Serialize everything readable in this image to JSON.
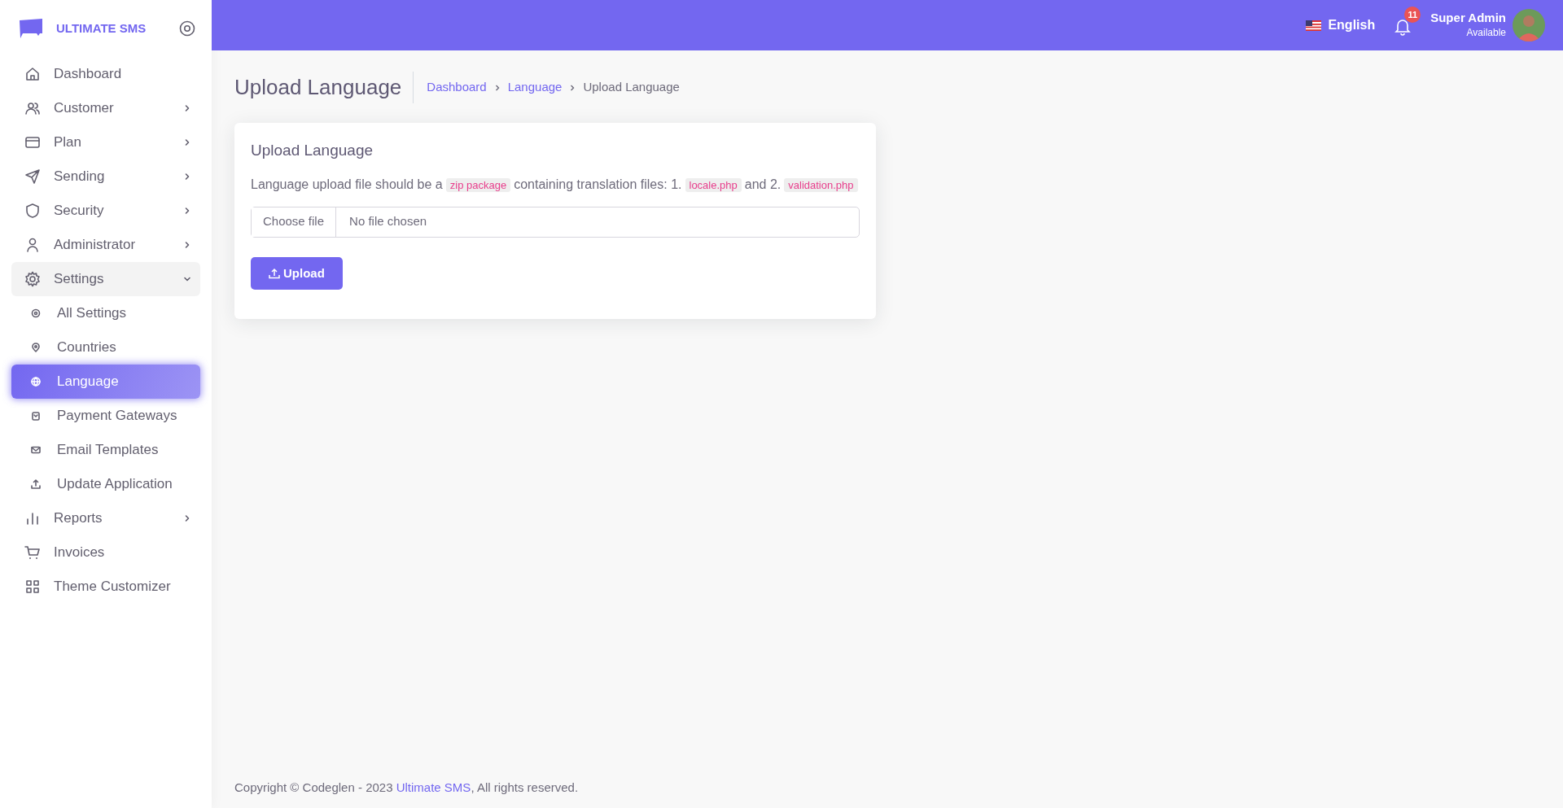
{
  "brand": {
    "name": "ULTIMATE SMS"
  },
  "sidebar": {
    "items": [
      {
        "label": "Dashboard",
        "kind": "main",
        "has_submenu": false,
        "expanded": false,
        "selected": false
      },
      {
        "label": "Customer",
        "kind": "main",
        "has_submenu": true,
        "expanded": false,
        "selected": false
      },
      {
        "label": "Plan",
        "kind": "main",
        "has_submenu": true,
        "expanded": false,
        "selected": false
      },
      {
        "label": "Sending",
        "kind": "main",
        "has_submenu": true,
        "expanded": false,
        "selected": false
      },
      {
        "label": "Security",
        "kind": "main",
        "has_submenu": true,
        "expanded": false,
        "selected": false
      },
      {
        "label": "Administrator",
        "kind": "main",
        "has_submenu": true,
        "expanded": false,
        "selected": false
      },
      {
        "label": "Settings",
        "kind": "main",
        "has_submenu": true,
        "expanded": true,
        "selected": false
      },
      {
        "label": "All Settings",
        "kind": "sub",
        "has_submenu": false,
        "expanded": false,
        "selected": false
      },
      {
        "label": "Countries",
        "kind": "sub",
        "has_submenu": false,
        "expanded": false,
        "selected": false
      },
      {
        "label": "Language",
        "kind": "sub",
        "has_submenu": false,
        "expanded": false,
        "selected": true
      },
      {
        "label": "Payment Gateways",
        "kind": "sub",
        "has_submenu": false,
        "expanded": false,
        "selected": false
      },
      {
        "label": "Email Templates",
        "kind": "sub",
        "has_submenu": false,
        "expanded": false,
        "selected": false
      },
      {
        "label": "Update Application",
        "kind": "sub",
        "has_submenu": false,
        "expanded": false,
        "selected": false
      },
      {
        "label": "Reports",
        "kind": "main",
        "has_submenu": true,
        "expanded": false,
        "selected": false
      },
      {
        "label": "Invoices",
        "kind": "main",
        "has_submenu": false,
        "expanded": false,
        "selected": false
      },
      {
        "label": "Theme Customizer",
        "kind": "main",
        "has_submenu": false,
        "expanded": false,
        "selected": false
      }
    ]
  },
  "topbar": {
    "language": "English",
    "notification_count": "11",
    "user_name": "Super Admin",
    "user_status": "Available"
  },
  "page": {
    "title": "Upload Language",
    "breadcrumb": [
      {
        "label": "Dashboard",
        "kind": "link"
      },
      {
        "label": "Language",
        "kind": "link"
      },
      {
        "label": "Upload Language",
        "kind": "current"
      }
    ]
  },
  "card": {
    "title": "Upload Language",
    "description": [
      {
        "kind": "text",
        "text": "Language upload file should be a"
      },
      {
        "kind": "code",
        "text": "zip package"
      },
      {
        "kind": "text",
        "text": "containing translation files: 1."
      },
      {
        "kind": "code",
        "text": "locale.php"
      },
      {
        "kind": "text",
        "text": "and 2."
      },
      {
        "kind": "code",
        "text": "validation.php"
      }
    ],
    "file_button": "Choose file",
    "file_status": "No file chosen",
    "submit": "Upload"
  },
  "footer": {
    "copyright": "Copyright © Codeglen - 2023",
    "link": "Ultimate SMS",
    "rights": ", All rights reserved."
  }
}
